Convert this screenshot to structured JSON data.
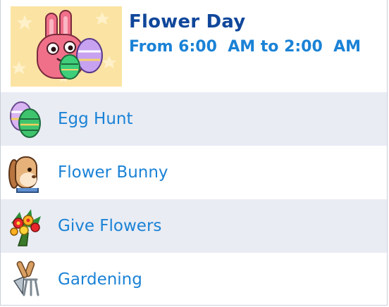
{
  "event": {
    "title": "Flower Day",
    "time": "From 6:00  AM to 2:00  AM",
    "hero_icon": "bunny-with-eggs-icon"
  },
  "activities": [
    {
      "label": "Egg Hunt",
      "icon": "easter-eggs-icon"
    },
    {
      "label": "Flower Bunny",
      "icon": "bunny-head-icon"
    },
    {
      "label": "Give Flowers",
      "icon": "flower-bouquet-icon"
    },
    {
      "label": "Gardening",
      "icon": "garden-tools-icon"
    }
  ],
  "colors": {
    "title": "#10479b",
    "label": "#1a82d6",
    "row_alt": "#e9ecf3",
    "hero_bg": "#fbe3a3"
  }
}
